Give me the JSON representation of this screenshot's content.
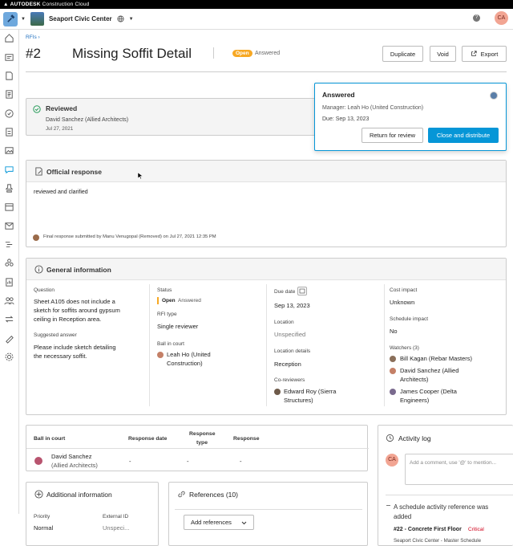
{
  "brand": {
    "name": "AUTODESK",
    "product": "Construction Cloud"
  },
  "project": {
    "name": "Seaport Civic Center"
  },
  "user": {
    "initials": "CA"
  },
  "breadcrumb": "RFIs ›",
  "rfi": {
    "number": "#2",
    "title": "Missing Soffit Detail",
    "status_badge": "Open",
    "status_text": "Answered"
  },
  "actions": {
    "duplicate": "Duplicate",
    "void": "Void",
    "export": "Export"
  },
  "answered_popup": {
    "title": "Answered",
    "manager": "Manager: Leah Ho (United Construction)",
    "due": "Due: Sep 13, 2023",
    "return_btn": "Return for review",
    "close_btn": "Close and distribute"
  },
  "reviewed": {
    "title": "Reviewed",
    "by": "David Sanchez (Allied Architects)",
    "date": "Jul 27, 2021"
  },
  "official_response": {
    "title": "Official response",
    "text": "reviewed and clarified",
    "footer": "Final response submitted by Manu Venugopal (Removed) on Jul 27, 2021 12:35 PM"
  },
  "general": {
    "title": "General information",
    "question_label": "Question",
    "question": [
      "Sheet A105 does not include a",
      "sketch for soffits around gypsum",
      "ceiling in Reception area."
    ],
    "suggested_label": "Suggested answer",
    "suggested": [
      "Please include sketch detailing",
      "the necessary soffit."
    ],
    "status_label": "Status",
    "status_badge": "Open",
    "status_value": "Answered",
    "rfi_type_label": "RFI type",
    "rfi_type": "Single reviewer",
    "ball_label": "Ball in court",
    "ball": [
      "Leah Ho (United",
      "Construction)"
    ],
    "due_label": "Due date",
    "due": "Sep 13, 2023",
    "location_label": "Location",
    "location": "Unspecified",
    "location_details_label": "Location details",
    "location_details": "Reception",
    "coreviewers_label": "Co-reviewers",
    "coreviewers": [
      "Edward Roy (Sierra",
      "Structures)"
    ],
    "cost_label": "Cost impact",
    "cost": "Unknown",
    "schedule_label": "Schedule impact",
    "schedule": "No",
    "watchers_label": "Watchers (3)",
    "watchers": [
      [
        "Bill Kagan (Rebar Masters)"
      ],
      [
        "David Sanchez (Allied",
        "Architects)"
      ],
      [
        "James Cooper (Delta",
        "Engineers)"
      ]
    ]
  },
  "ball_table": {
    "headers": [
      "Ball in court",
      "Response date",
      "Response",
      "type",
      "Response"
    ],
    "row": {
      "name": [
        "David Sanchez",
        "(Allied Architects)"
      ],
      "date": "-",
      "type": "-",
      "response": "-"
    }
  },
  "additional": {
    "title": "Additional information",
    "priority_label": "Priority",
    "priority": "Normal",
    "external_label": "External ID",
    "external": "Unspeci..."
  },
  "references": {
    "title": "References (10)",
    "add_btn": "Add references"
  },
  "activity": {
    "title": "Activity log",
    "avatar": "CA",
    "placeholder": "Add a comment, use '@' to mention...",
    "entry_title": [
      "A schedule activity reference was",
      "added"
    ],
    "entry_item": "#22 - Concrete First Floor",
    "entry_flag": "Critical",
    "entry_sub": "Seaport Civic Center - Master Schedule"
  },
  "colors": {
    "accent": "#0696d7",
    "open": "#f7a823",
    "critical": "#d0021b"
  }
}
